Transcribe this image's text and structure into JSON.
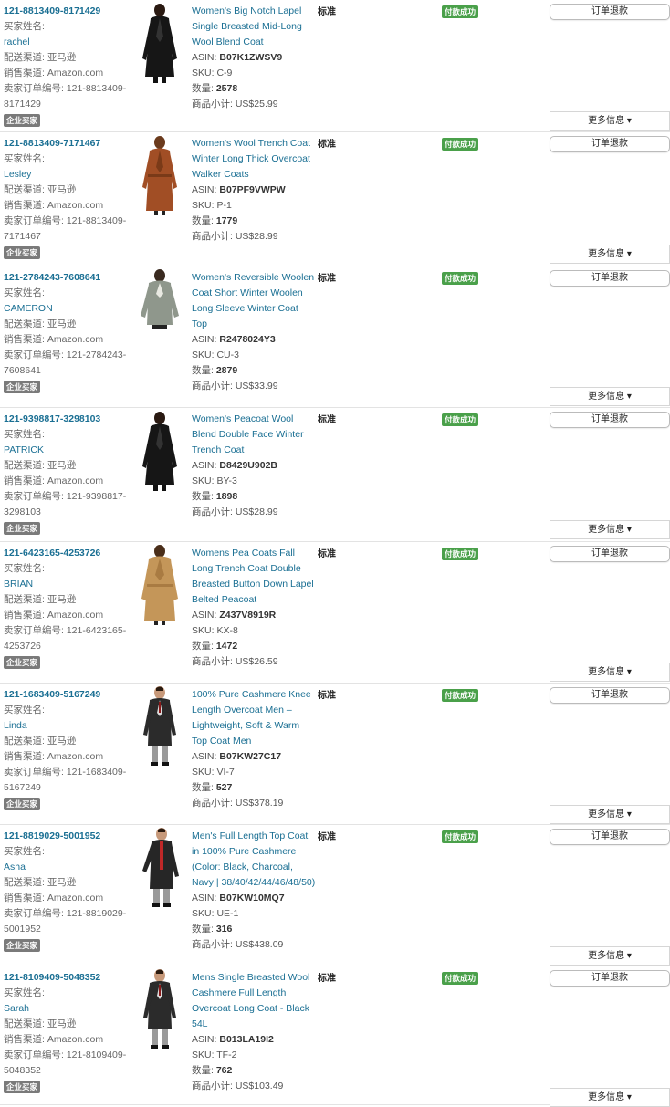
{
  "labels": {
    "buyer_name": "买家姓名:",
    "fulfillment": "配送渠道: 亚马逊",
    "channel": "销售渠道: Amazon.com",
    "seller_order": "卖家订单编号:",
    "business": "企业买家",
    "asin": "ASIN:",
    "sku": "SKU:",
    "qty": "数量:",
    "subtotal": "商品小计:",
    "shipping": "标准",
    "status": "付款成功",
    "refund": "订单退款",
    "more": "更多信息 ▾"
  },
  "orders": [
    {
      "id": "121-8813409-8171429",
      "buyer": "rachel",
      "seller_id_1": "121-8813409-",
      "seller_id_2": "8171429",
      "title": "Women's Big Notch Lapel Single Breasted Mid-Long Wool Blend Coat",
      "asin": "B07K1ZWSV9",
      "sku": "C-9",
      "qty": "2578",
      "subtotal": "US$25.99",
      "image": "black-coat-image"
    },
    {
      "id": "121-8813409-7171467",
      "buyer": "Lesley",
      "seller_id_1": "121-8813409-",
      "seller_id_2": "7171467",
      "title": "Women's Wool Trench Coat Winter Long Thick Overcoat Walker Coats",
      "asin": "B07PF9VWPW",
      "sku": "P-1",
      "qty": "1779",
      "subtotal": "US$28.99",
      "image": "brown-coat-image"
    },
    {
      "id": "121-2784243-7608641",
      "buyer": "CAMERON",
      "seller_id_1": "121-2784243-",
      "seller_id_2": "7608641",
      "title": "Women's Reversible Woolen Coat Short Winter Woolen Long Sleeve Winter Coat Top",
      "asin": "R2478024Y3",
      "sku": "CU-3",
      "qty": "2879",
      "subtotal": "US$33.99",
      "image": "grey-coat-image"
    },
    {
      "id": "121-9398817-3298103",
      "buyer": "PATRICK",
      "seller_id_1": "121-9398817-",
      "seller_id_2": "3298103",
      "title": "Women's Peacoat Wool Blend Double Face Winter Trench Coat",
      "asin": "D8429U902B",
      "sku": "BY-3",
      "qty": "1898",
      "subtotal": "US$28.99",
      "image": "black-coat-image"
    },
    {
      "id": "121-6423165-4253726",
      "buyer": "BRIAN",
      "seller_id_1": "121-6423165-",
      "seller_id_2": "4253726",
      "title": "Womens Pea Coats Fall Long Trench Coat Double Breasted Button Down Lapel Belted Peacoat",
      "asin": "Z437V8919R",
      "sku": "KX-8",
      "qty": "1472",
      "subtotal": "US$26.59",
      "image": "camel-coat-image"
    },
    {
      "id": "121-1683409-5167249",
      "buyer": "Linda",
      "seller_id_1": "121-1683409-",
      "seller_id_2": "5167249",
      "title": "100% Pure Cashmere Knee Length Overcoat Men – Lightweight, Soft & Warm Top Coat Men",
      "asin": "B07KW27C17",
      "sku": "VI-7",
      "qty": "527",
      "subtotal": "US$378.19",
      "image": "mens-coat-image"
    },
    {
      "id": "121-8819029-5001952",
      "buyer": "Asha",
      "seller_id_1": "121-8819029-",
      "seller_id_2": "5001952",
      "title": "Men's Full Length Top Coat in 100% Pure Cashmere (Color: Black, Charcoal, Navy | 38/40/42/44/46/48/50)",
      "asin": "B07KW10MQ7",
      "sku": "UE-1",
      "qty": "316",
      "subtotal": "US$438.09",
      "image": "mens-coat-scarf-image"
    },
    {
      "id": "121-8109409-5048352",
      "buyer": "Sarah",
      "seller_id_1": "121-8109409-",
      "seller_id_2": "5048352",
      "title": "Mens Single Breasted Wool Cashmere Full Length Overcoat Long Coat - Black 54L",
      "asin": "B013LA19I2",
      "sku": "TF-2",
      "qty": "762",
      "subtotal": "US$103.49",
      "image": "mens-coat-image"
    }
  ]
}
